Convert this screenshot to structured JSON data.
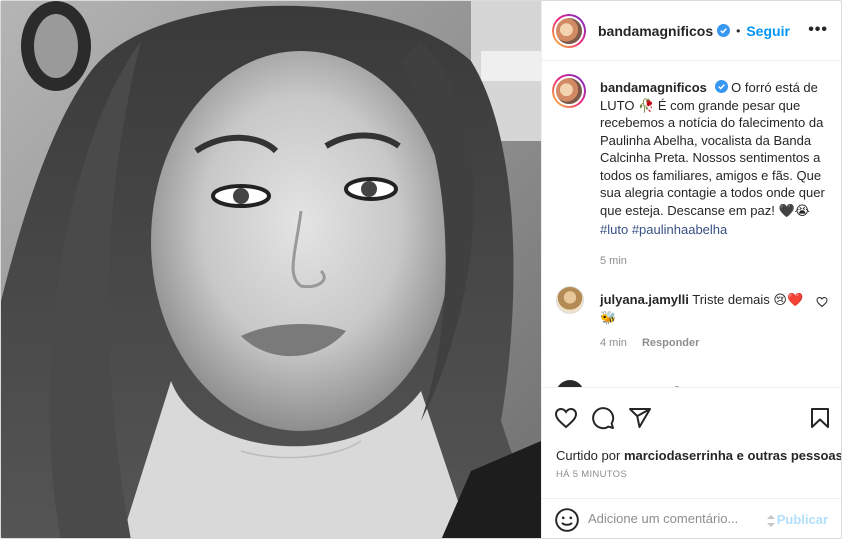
{
  "post": {
    "username": "bandamagnificos",
    "follow_label": "Seguir",
    "more_label": "•••",
    "caption": {
      "username": "bandamagnificos",
      "text": "O forró está de LUTO 🥀 É com grande pesar que recebemos a notícia do falecimento da Paulinha Abelha, vocalista da Banda Calcinha Preta. Nossos sentimentos a todos os familiares, amigos e fãs. Que sua alegria contagie a todos onde quer que esteja. Descanse em paz! 🖤😭",
      "hashtag1": "#luto",
      "hashtag2": "#paulinhaabelha",
      "time": "5 min"
    },
    "comments": [
      {
        "username": "julyana.jamylli",
        "text": "Triste demais 😢❤️🐝",
        "time": "4 min",
        "reply_label": "Responder"
      },
      {
        "username": "pablealves",
        "text": "😢"
      }
    ],
    "liked_by_prefix": "Curtido por",
    "liked_by_user": "marciodaserrinha",
    "liked_by_suffix": "e outras pessoas",
    "ago": "HÁ 5 MINUTOS",
    "comment_placeholder": "Adicione um comentário...",
    "publish_label": "Publicar"
  },
  "colors": {
    "link_blue": "#0095f6",
    "hashtag": "#00376b",
    "muted": "#8e8e8e",
    "publish_disabled": "#b2dffc"
  },
  "icons": [
    "verified-badge-icon",
    "more-options-icon",
    "heart-icon",
    "comment-icon",
    "share-icon",
    "bookmark-icon",
    "emoji-icon",
    "comment-like-icon"
  ]
}
